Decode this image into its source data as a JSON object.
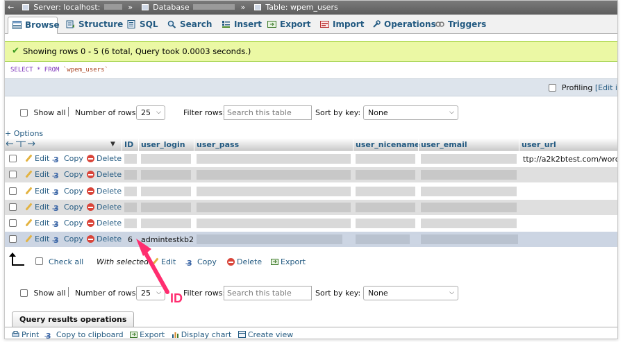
{
  "breadcrumb": {
    "back": "←",
    "server_label": "Server: localhost:",
    "database_label": "Database",
    "table_label": "Table: wpem_users",
    "separator": "»"
  },
  "tabs": [
    {
      "label": "Browse",
      "icon": "browse-icon",
      "active": true
    },
    {
      "label": "Structure",
      "icon": "structure-icon"
    },
    {
      "label": "SQL",
      "icon": "sql-icon"
    },
    {
      "label": "Search",
      "icon": "search-icon"
    },
    {
      "label": "Insert",
      "icon": "insert-icon"
    },
    {
      "label": "Export",
      "icon": "export-icon"
    },
    {
      "label": "Import",
      "icon": "import-icon"
    },
    {
      "label": "Operations",
      "icon": "operations-icon"
    },
    {
      "label": "Triggers",
      "icon": "triggers-icon"
    }
  ],
  "message": {
    "text": "Showing rows 0 - 5 (6 total, Query took 0.0003 seconds.)",
    "color": "#ebf8a4"
  },
  "sql": {
    "select": "SELECT",
    "star": "*",
    "from": "FROM",
    "table": "`wpem_users`"
  },
  "profiling": {
    "label": "Profiling",
    "edit": "[Edit i"
  },
  "nav_top": {
    "show_all": "Show all",
    "num_rows_label": "Number of rows:",
    "num_rows_value": "25",
    "filter_label": "Filter rows:",
    "filter_placeholder": "Search this table",
    "sort_label": "Sort by key:",
    "sort_value": "None"
  },
  "options_link": "+ Options",
  "columns": {
    "id": "ID",
    "user_login": "user_login",
    "user_pass": "user_pass",
    "user_nicename": "user_nicename",
    "user_email": "user_email",
    "user_url": "user_url"
  },
  "actions": {
    "edit": "Edit",
    "copy": "Copy",
    "delete": "Delete"
  },
  "rows": [
    {
      "id": "",
      "user_login": "",
      "user_url": "ttp://a2k2btest.com/wordpress"
    },
    {
      "id": "",
      "user_login": "",
      "user_url": ""
    },
    {
      "id": "",
      "user_login": "",
      "user_url": ""
    },
    {
      "id": "",
      "user_login": "",
      "user_url": ""
    },
    {
      "id": "",
      "user_login": "",
      "user_url": ""
    },
    {
      "id": "6",
      "user_login": "admintestkb2",
      "user_url": ""
    }
  ],
  "bottom_actions": {
    "check_all": "Check all",
    "with_selected": "With selected:",
    "edit": "Edit",
    "copy": "Copy",
    "delete": "Delete",
    "export": "Export"
  },
  "nav_bottom": {
    "show_all": "Show all",
    "num_rows_label": "Number of rows:",
    "num_rows_value": "25",
    "filter_label": "Filter rows:",
    "filter_placeholder": "Search this table",
    "sort_label": "Sort by key:",
    "sort_value": "None"
  },
  "annotation": {
    "label": "ID",
    "color": "#ff2d6f"
  },
  "query_results": {
    "title": "Query results operations",
    "links": [
      "Print",
      "Copy to clipboard",
      "Export",
      "Display chart",
      "Create view"
    ]
  }
}
